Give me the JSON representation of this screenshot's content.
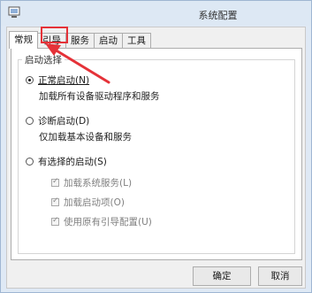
{
  "window": {
    "title": "系统配置"
  },
  "tabs": [
    "常规",
    "引导",
    "服务",
    "启动",
    "工具"
  ],
  "group": {
    "title": "启动选择",
    "options": [
      {
        "label": "正常启动(N)",
        "desc": "加载所有设备驱动程序和服务",
        "selected": true
      },
      {
        "label": "诊断启动(D)",
        "desc": "仅加载基本设备和服务",
        "selected": false
      },
      {
        "label": "有选择的启动(S)",
        "selected": false
      }
    ],
    "sub_options": [
      {
        "label": "加载系统服务(L)",
        "checked": true
      },
      {
        "label": "加载启动项(O)",
        "checked": true
      },
      {
        "label": "使用原有引导配置(U)",
        "checked": true
      }
    ]
  },
  "buttons": {
    "ok": "确定",
    "cancel": "取消"
  },
  "annotation": {
    "highlight_color": "#e53238",
    "highlighted_tab": "引导",
    "arrow_color": "#e53238"
  }
}
